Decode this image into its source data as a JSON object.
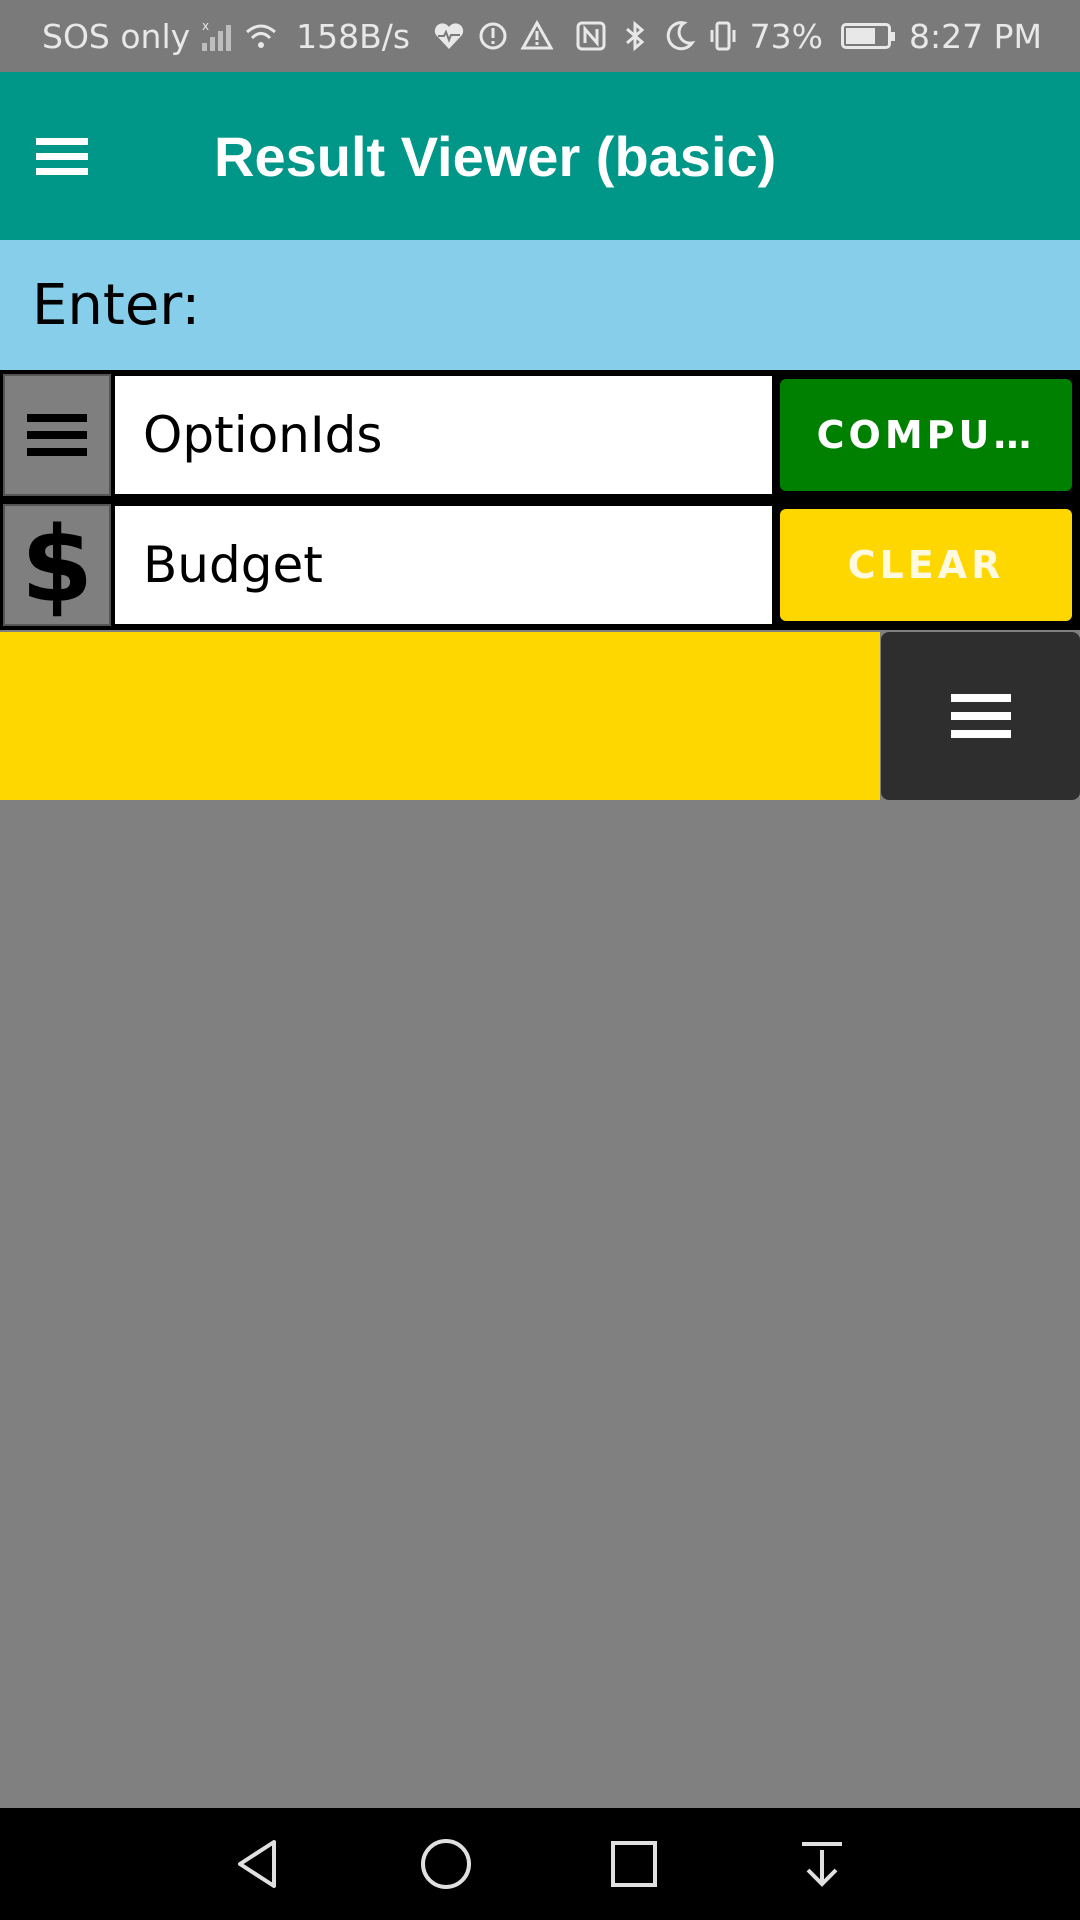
{
  "status_bar": {
    "carrier": "SOS only",
    "speed": "158B/s",
    "battery": "73%",
    "battery_level": 0.73,
    "time": "8:27 PM",
    "icons": [
      "signal-icon",
      "wifi-icon",
      "health-icon",
      "alert-circle-icon",
      "warning-icon",
      "nfc-icon",
      "bluetooth-icon",
      "moon-icon",
      "vibrate-icon",
      "battery-icon"
    ]
  },
  "app_bar": {
    "title": "Result Viewer (basic)",
    "menu_icon": "hamburger-menu-icon"
  },
  "enter_label": "Enter:",
  "rows": [
    {
      "icon": "list-icon",
      "value": "OptionIds",
      "button_label": "COMPU…",
      "button_color": "#008000"
    },
    {
      "icon": "dollar-icon",
      "icon_glyph": "$",
      "value": "Budget",
      "button_label": "CLEAR",
      "button_color": "#ffd700"
    }
  ],
  "result_menu_icon": "hamburger-menu-icon",
  "colors": {
    "app_bar": "#009688",
    "enter_bar": "#87ceeb",
    "result_bar": "#ffd700",
    "background": "#808080"
  },
  "nav_bar": {
    "buttons": [
      "back-icon",
      "home-icon",
      "recents-icon",
      "notifications-pull-icon"
    ]
  }
}
